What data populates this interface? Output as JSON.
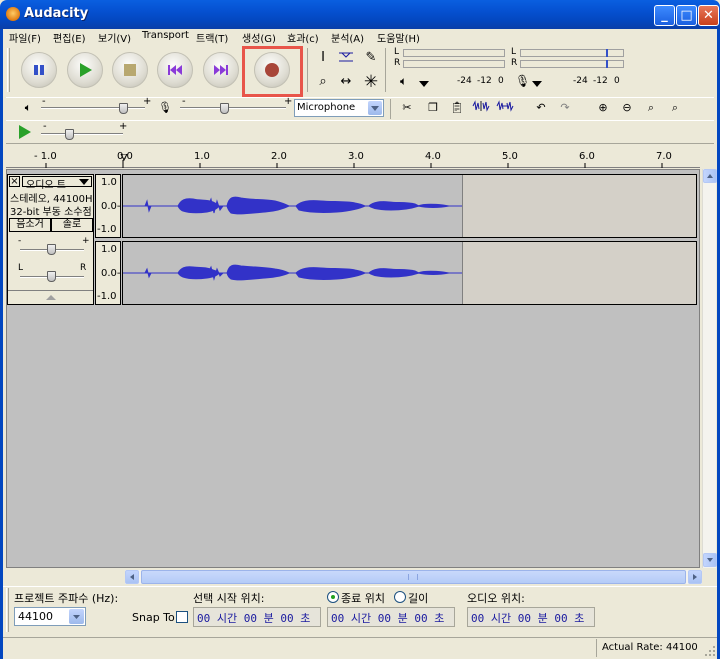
{
  "window": {
    "title": "Audacity"
  },
  "menu": [
    "파일(F)",
    "편집(E)",
    "보기(V)",
    "Transport",
    "트랙(T)",
    "생성(G)",
    "효과(c)",
    "분석(A)",
    "도움말(H)"
  ],
  "meters": {
    "play_l": "L",
    "play_r": "R",
    "rec_l": "L",
    "rec_r": "R",
    "ticks": [
      "-24",
      "-12",
      "0"
    ]
  },
  "mixer": {
    "input_source": "Microphone"
  },
  "ruler": {
    "ticks": [
      "- 1.0",
      "0.0",
      "1.0",
      "2.0",
      "3.0",
      "4.0",
      "5.0",
      "6.0",
      "7.0"
    ]
  },
  "track": {
    "close": "×",
    "name": "오디오 트",
    "info1": "스테레오, 44100H",
    "info2": "32-bit 부동 소수점",
    "mute": "음소거",
    "solo": "솔로",
    "minus": "-",
    "plus": "+",
    "pan_l": "L",
    "pan_r": "R",
    "scale": [
      "1.0",
      "0.0-",
      "-1.0"
    ]
  },
  "selection": {
    "rate_label": "프로젝트 주파수 (Hz):",
    "rate_value": "44100",
    "snap_label": "Snap To",
    "start_label": "선택 시작 위치:",
    "end_label": "종료 위치",
    "length_label": "길이",
    "audio_pos_label": "오디오 위치:",
    "time_value": "00 시간 00 분 00 초"
  },
  "status": {
    "rate": "Actual Rate: 44100"
  }
}
